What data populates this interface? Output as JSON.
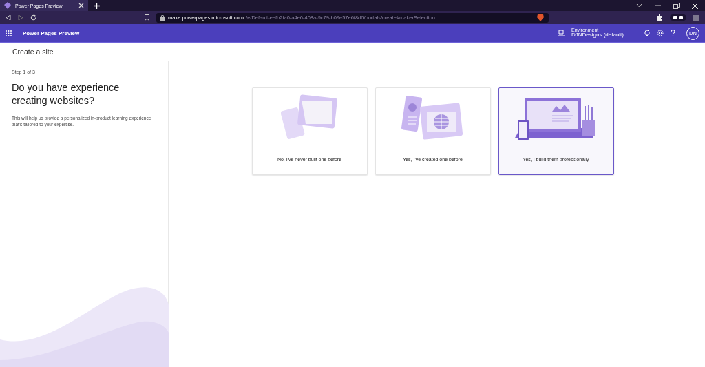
{
  "browser": {
    "tab_title": "Power Pages Preview",
    "url_host": "make.powerpages.microsoft.com",
    "url_path": "/e/Default-eefb2fa0-a4e6-408a-9c79-b09e57e6f8d6/portals/create#makerSelection"
  },
  "app_bar": {
    "title": "Power Pages Preview",
    "environment_label": "Environment",
    "environment": "DJNDesigns (default)",
    "avatar": "DN"
  },
  "page_title": "Create a site",
  "step": "Step 1 of 3",
  "question": "Do you have experience creating websites?",
  "description": "This will help us provide a personalized in-product learning experience that's tailored to your expertise.",
  "options": [
    {
      "kind": "papers",
      "label": "No, I've never built one before",
      "selected": false
    },
    {
      "kind": "devices",
      "label": "Yes, I've created one before",
      "selected": false
    },
    {
      "kind": "workspace",
      "label": "Yes, I build them professionally",
      "selected": true
    }
  ]
}
